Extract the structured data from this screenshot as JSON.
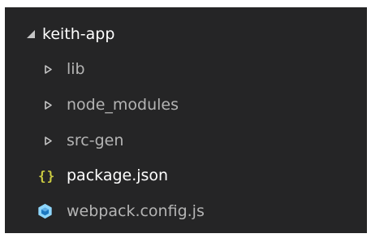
{
  "explorer": {
    "root": {
      "label": "keith-app",
      "icon": "chevron-expanded-icon"
    },
    "items": [
      {
        "label": "lib",
        "type": "folder",
        "icon": "chevron-collapsed-icon"
      },
      {
        "label": "node_modules",
        "type": "folder",
        "icon": "chevron-collapsed-icon"
      },
      {
        "label": "src-gen",
        "type": "folder",
        "icon": "chevron-collapsed-icon"
      },
      {
        "label": "package.json",
        "type": "file",
        "icon": "json-file-icon",
        "icon_glyph": "{}"
      },
      {
        "label": "webpack.config.js",
        "type": "file",
        "icon": "webpack-icon"
      }
    ],
    "colors": {
      "background": "#252526",
      "text": "#cccccc",
      "json_icon": "#cbcb41",
      "webpack_icon": "#8ed6fb"
    }
  }
}
